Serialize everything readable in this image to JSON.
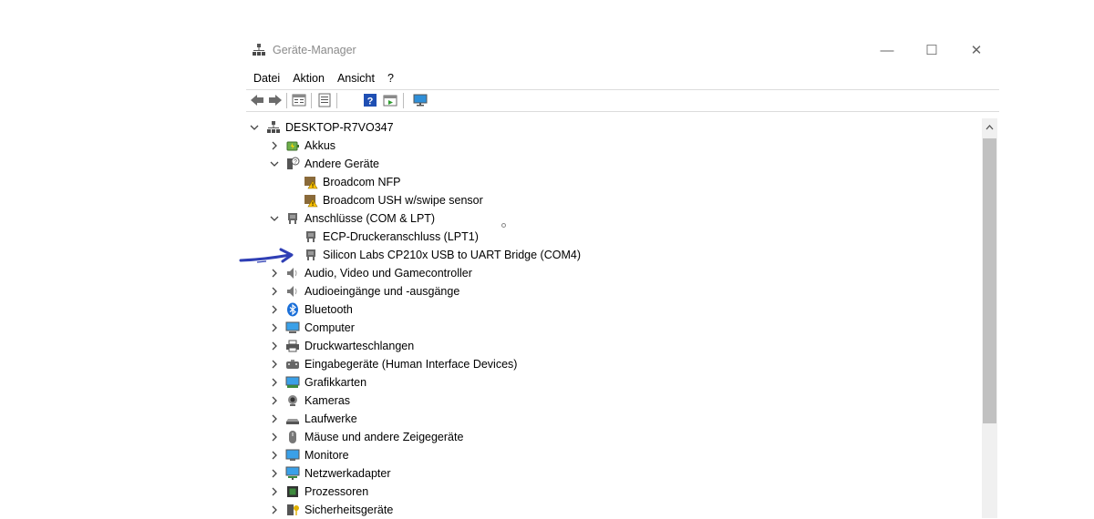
{
  "window": {
    "title": "Geräte-Manager",
    "controls": [
      "—",
      "☐",
      "✕"
    ]
  },
  "menu": [
    "Datei",
    "Aktion",
    "Ansicht",
    "?"
  ],
  "toolbar": [
    "back-icon",
    "forward-icon",
    "properties-view-icon",
    "list-view-icon",
    "help-icon",
    "update-driver-icon",
    "monitor-icon"
  ],
  "tree": {
    "root": "DESKTOP-R7VO347",
    "categories": [
      {
        "label": "Akkus",
        "expanded": false,
        "icon": "battery-icon"
      },
      {
        "label": "Andere Geräte",
        "expanded": true,
        "icon": "unknown-device-icon",
        "children": [
          "Broadcom NFP",
          "Broadcom USH w/swipe sensor"
        ]
      },
      {
        "label": "Anschlüsse (COM & LPT)",
        "expanded": true,
        "icon": "port-icon",
        "children": [
          "ECP-Druckeranschluss (LPT1)",
          "Silicon Labs CP210x USB to UART Bridge (COM4)"
        ]
      },
      {
        "label": "Audio, Video und Gamecontroller",
        "expanded": false,
        "icon": "speaker-icon"
      },
      {
        "label": "Audioeingänge und -ausgänge",
        "expanded": false,
        "icon": "speaker-icon"
      },
      {
        "label": "Bluetooth",
        "expanded": false,
        "icon": "bluetooth-icon"
      },
      {
        "label": "Computer",
        "expanded": false,
        "icon": "computer-icon"
      },
      {
        "label": "Druckwarteschlangen",
        "expanded": false,
        "icon": "printer-icon"
      },
      {
        "label": "Eingabegeräte (Human Interface Devices)",
        "expanded": false,
        "icon": "hid-icon"
      },
      {
        "label": "Grafikkarten",
        "expanded": false,
        "icon": "display-adapter-icon"
      },
      {
        "label": "Kameras",
        "expanded": false,
        "icon": "camera-icon"
      },
      {
        "label": "Laufwerke",
        "expanded": false,
        "icon": "disk-drive-icon"
      },
      {
        "label": "Mäuse und andere Zeigegeräte",
        "expanded": false,
        "icon": "mouse-icon"
      },
      {
        "label": "Monitore",
        "expanded": false,
        "icon": "monitor-icon"
      },
      {
        "label": "Netzwerkadapter",
        "expanded": false,
        "icon": "network-adapter-icon"
      },
      {
        "label": "Prozessoren",
        "expanded": false,
        "icon": "processor-icon"
      },
      {
        "label": "Sicherheitsgeräte",
        "expanded": false,
        "icon": "security-device-icon"
      }
    ]
  },
  "colors": {
    "annotation_arrow": "#2f3fb5",
    "title_text": "#8a8a8a",
    "scrollbar_thumb": "#c1c1c1"
  }
}
